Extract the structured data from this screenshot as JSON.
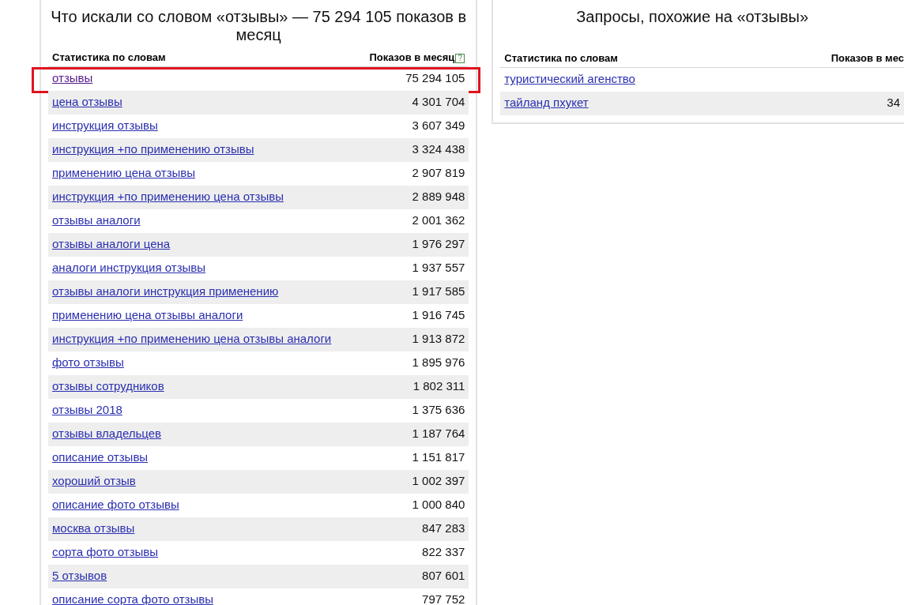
{
  "main_panel": {
    "title": "Что искали со словом «отзывы» — 75 294 105 показов в месяц",
    "columns": [
      "Статистика по словам",
      "Показов в месяц"
    ],
    "help_icon": "?",
    "rows": [
      {
        "phrase": "отзывы",
        "count": "75 294 105",
        "visited": true,
        "highlighted": true
      },
      {
        "phrase": "цена отзывы",
        "count": "4 301 704",
        "visited": false,
        "highlighted": false
      },
      {
        "phrase": "инструкция отзывы",
        "count": "3 607 349",
        "visited": false,
        "highlighted": false
      },
      {
        "phrase": "инструкция +по применению отзывы",
        "count": "3 324 438",
        "visited": false,
        "highlighted": false
      },
      {
        "phrase": "применению цена отзывы",
        "count": "2 907 819",
        "visited": false,
        "highlighted": false
      },
      {
        "phrase": "инструкция +по применению цена отзывы",
        "count": "2 889 948",
        "visited": false,
        "highlighted": false
      },
      {
        "phrase": "отзывы аналоги",
        "count": "2 001 362",
        "visited": false,
        "highlighted": false
      },
      {
        "phrase": "отзывы аналоги цена",
        "count": "1 976 297",
        "visited": false,
        "highlighted": false
      },
      {
        "phrase": "аналоги инструкция отзывы",
        "count": "1 937 557",
        "visited": false,
        "highlighted": false
      },
      {
        "phrase": "отзывы аналоги инструкция применению",
        "count": "1 917 585",
        "visited": false,
        "highlighted": false
      },
      {
        "phrase": "применению цена отзывы аналоги",
        "count": "1 916 745",
        "visited": false,
        "highlighted": false
      },
      {
        "phrase": "инструкция +по применению цена отзывы аналоги",
        "count": "1 913 872",
        "visited": false,
        "highlighted": false
      },
      {
        "phrase": "фото отзывы",
        "count": "1 895 976",
        "visited": false,
        "highlighted": false
      },
      {
        "phrase": "отзывы сотрудников",
        "count": "1 802 311",
        "visited": false,
        "highlighted": false
      },
      {
        "phrase": "отзывы 2018",
        "count": "1 375 636",
        "visited": false,
        "highlighted": false
      },
      {
        "phrase": "отзывы владельцев",
        "count": "1 187 764",
        "visited": false,
        "highlighted": false
      },
      {
        "phrase": "описание отзывы",
        "count": "1 151 817",
        "visited": false,
        "highlighted": false
      },
      {
        "phrase": "хороший отзыв",
        "count": "1 002 397",
        "visited": false,
        "highlighted": false
      },
      {
        "phrase": "описание фото отзывы",
        "count": "1 000 840",
        "visited": false,
        "highlighted": false
      },
      {
        "phrase": "москва отзывы",
        "count": "847 283",
        "visited": false,
        "highlighted": false
      },
      {
        "phrase": "сорта фото отзывы",
        "count": "822 337",
        "visited": false,
        "highlighted": false
      },
      {
        "phrase": "5 отзывов",
        "count": "807 601",
        "visited": false,
        "highlighted": false
      },
      {
        "phrase": "описание сорта фото отзывы",
        "count": "797 752",
        "visited": false,
        "highlighted": false
      }
    ]
  },
  "similar_panel": {
    "title": "Запросы, похожие на «отзывы»",
    "columns": [
      "Статистика по словам",
      "Показов в мес"
    ],
    "rows": [
      {
        "phrase": "туристический агенство"
      },
      {
        "phrase": "тайланд пхукет",
        "count": "34"
      }
    ]
  }
}
